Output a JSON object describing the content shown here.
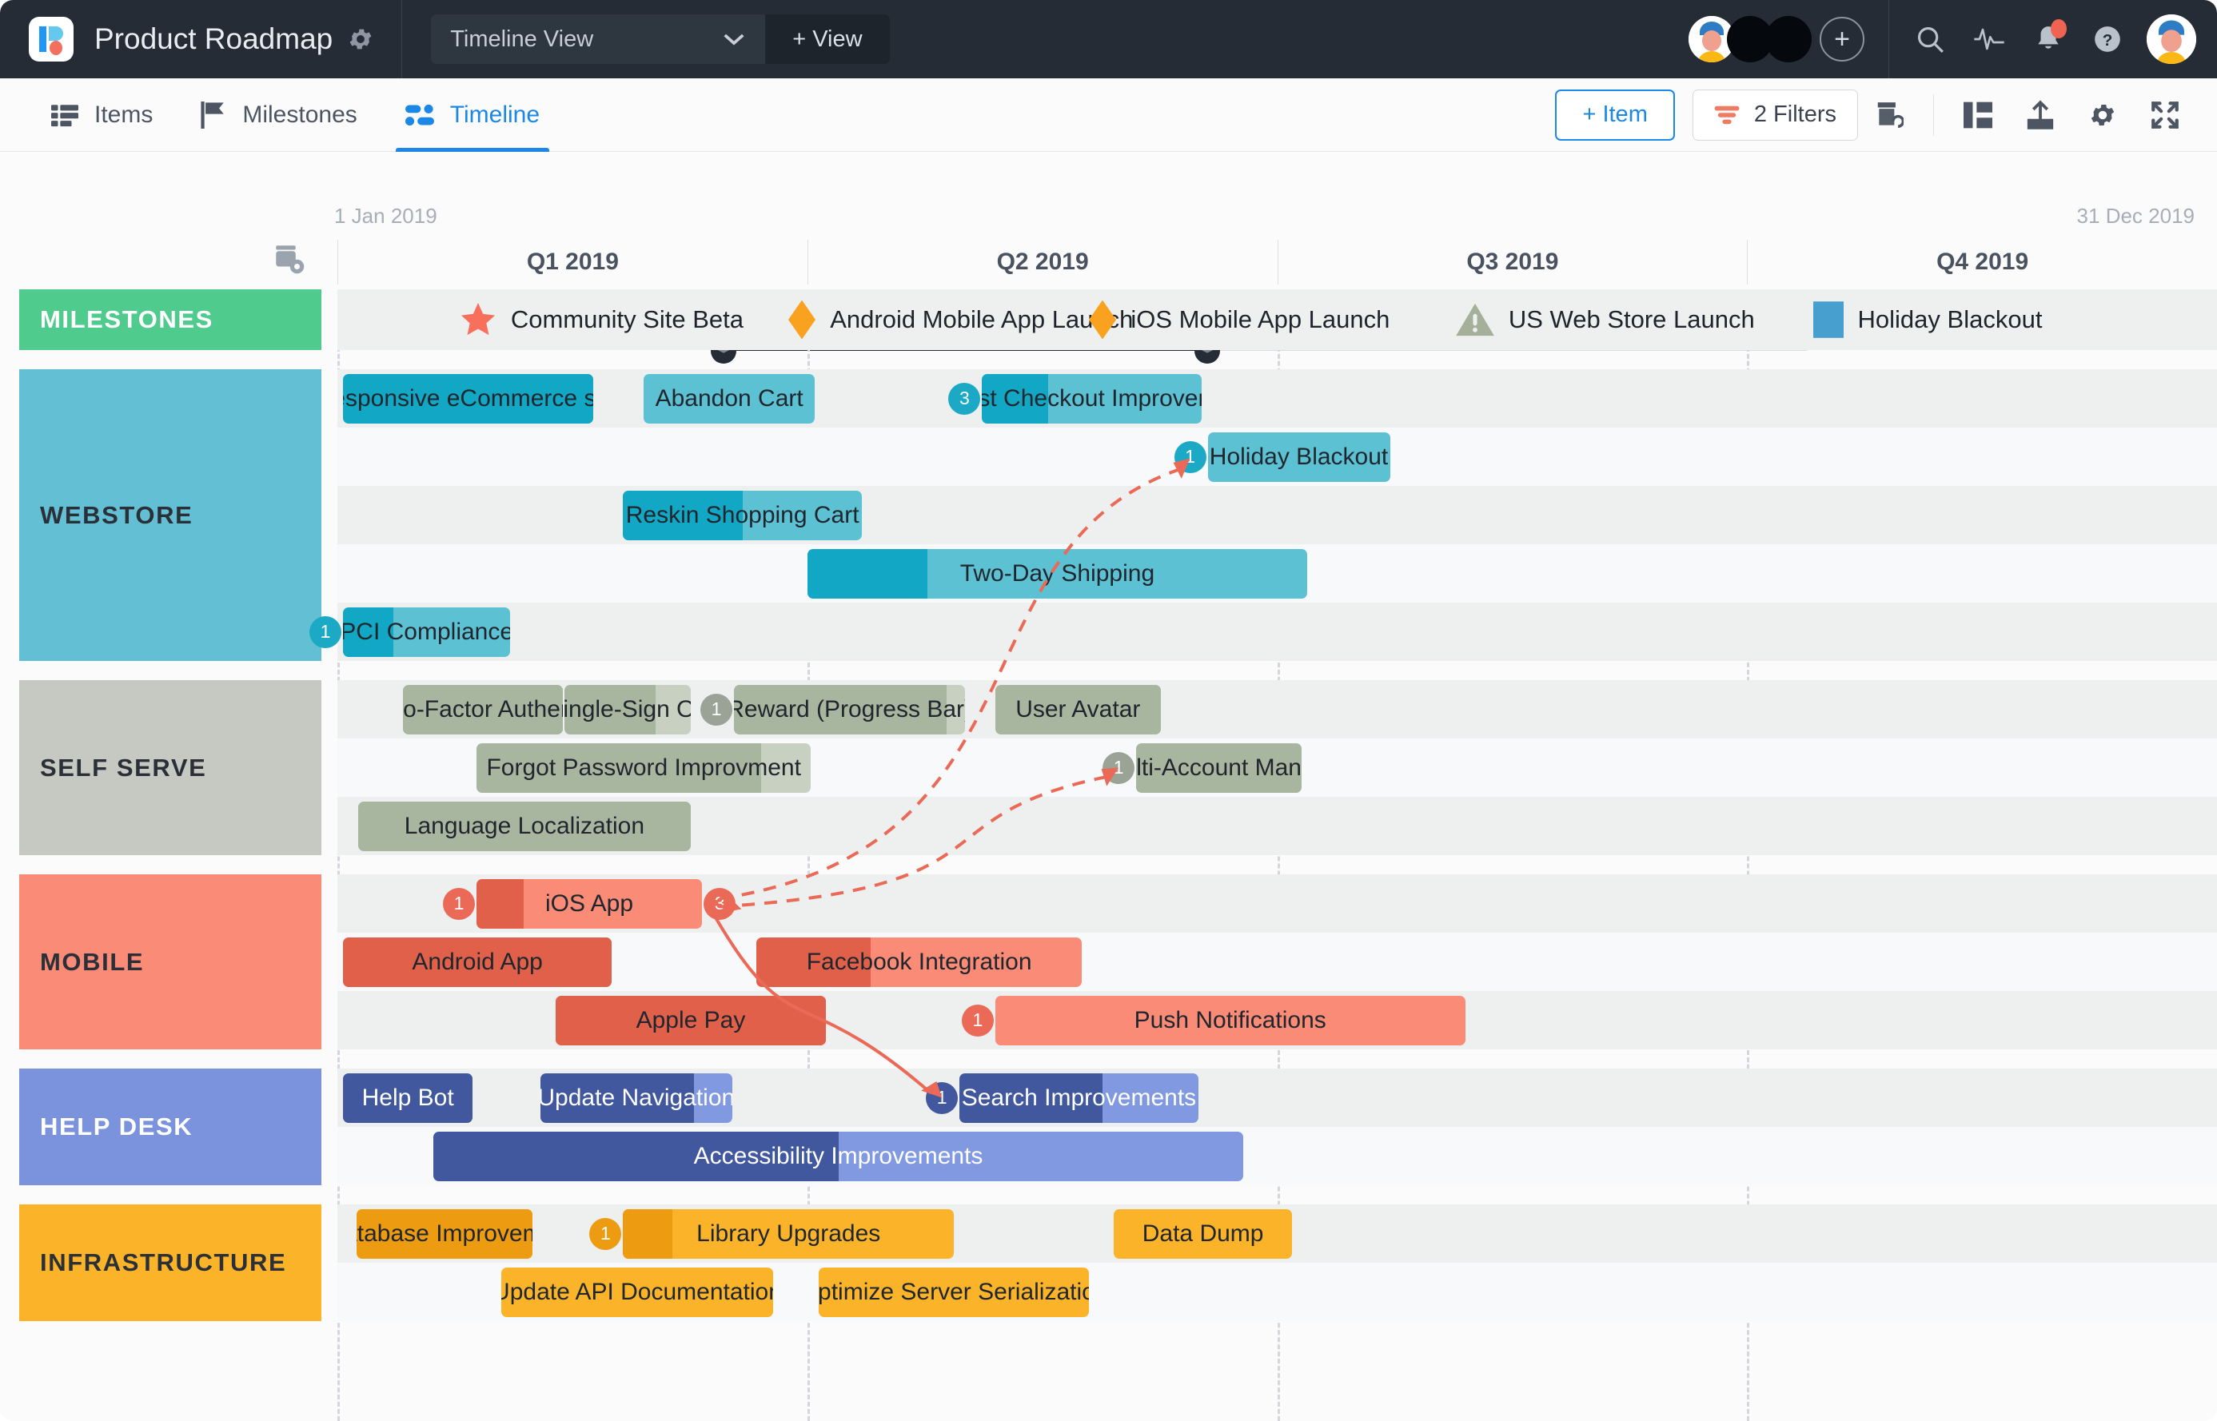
{
  "topbar": {
    "app_title": "Product Roadmap",
    "settings_icon": "gear-icon",
    "view_name": "Timeline View",
    "add_view_label": "+ View",
    "icons": [
      "search-icon",
      "activity-icon",
      "bell-icon",
      "help-icon"
    ]
  },
  "tabs": [
    {
      "label": "Items",
      "icon": "list-icon",
      "active": false
    },
    {
      "label": "Milestones",
      "icon": "flag-icon",
      "active": false
    },
    {
      "label": "Timeline",
      "icon": "timeline-icon",
      "active": true
    }
  ],
  "toolbar": {
    "add_item_label": "+ Item",
    "filters_label": "2 Filters",
    "icons": [
      "link-icon",
      "panel-layout-icon",
      "export-icon",
      "gear-icon",
      "fullscreen-icon"
    ]
  },
  "timeline": {
    "start_date": "1 Jan 2019",
    "end_date": "31 Dec 2019",
    "quarters": [
      "Q1 2019",
      "Q2 2019",
      "Q3 2019",
      "Q4 2019"
    ],
    "calendar_icon": "calendar-settings-icon"
  },
  "colors": {
    "milestones": "#4ecb8d",
    "webstore": "#63c0d4",
    "webstore_bar": "#5dc1d4",
    "webstore_fill": "#12a7c4",
    "self_serve": "#c5c9c1",
    "self_serve_bar": "#a8b6a0",
    "self_serve_fill": "#a8b6a0",
    "self_serve_rest": "#c7d0c1",
    "mobile": "#f98b77",
    "mobile_bar": "#f98b77",
    "mobile_fill": "#e0604a",
    "help_desk": "#7b93dd",
    "help_desk_bar": "#8199e0",
    "help_desk_fill": "#41589f",
    "infrastructure": "#fbb429",
    "infra_bar": "#fbb429",
    "infra_fill": "#ed9b10",
    "accent_blue": "#1b87e6",
    "arrow": "#ea6a57"
  },
  "lanes": [
    {
      "name": "MILESTONES",
      "text_color": "#ffffff",
      "bg": "#4ecb8d",
      "milestones": [
        {
          "label": "Community Site Beta",
          "icon": "star-icon",
          "color": "#f8705c",
          "left": 6.5
        },
        {
          "label": "Android Mobile App Launch",
          "icon": "diamond-icon",
          "color": "#f9a220",
          "left": 24.0
        },
        {
          "label": "iOS Mobile App Launch",
          "icon": "diamond-icon",
          "color": "#f9a220",
          "left": 40.0
        },
        {
          "label": "US Web Store Launch",
          "icon": "warning-icon",
          "color": "#a4b09a",
          "left": 59.5
        },
        {
          "label": "Holiday Blackout",
          "icon": "square-icon",
          "color": "#479fd0",
          "left": 78.5
        }
      ]
    },
    {
      "name": "WEBSTORE",
      "text_color": "#2b3038",
      "bg": "#63c0d4",
      "items": [
        {
          "label": "Responsive eCommerce site",
          "left": 0.3,
          "width": 13.3,
          "progress": 100,
          "row": 0
        },
        {
          "label": "Abandon Cart",
          "left": 16.3,
          "width": 9.1,
          "progress": 0,
          "row": 0
        },
        {
          "label": "Guest Checkout Improvement",
          "left": 34.3,
          "width": 11.7,
          "progress": 30,
          "row": 0,
          "badge": "3"
        },
        {
          "label": "Holiday Blackout",
          "left": 46.3,
          "width": 9.7,
          "progress": 0,
          "row": 1,
          "badge": "1"
        },
        {
          "label": "Reskin Shopping Cart",
          "left": 15.2,
          "width": 12.7,
          "progress": 50,
          "row": 2
        },
        {
          "label": "Two-Day Shipping",
          "left": 25.0,
          "width": 26.6,
          "progress": 24,
          "row": 3
        },
        {
          "label": "PCI Compliance",
          "left": 0.3,
          "width": 8.9,
          "progress": 30,
          "row": 4,
          "badge": "1"
        }
      ]
    },
    {
      "name": "SELF SERVE",
      "text_color": "#2b3038",
      "bg": "#c5c9c1",
      "items": [
        {
          "label": "Two-Factor Authen...",
          "left": 3.5,
          "width": 8.5,
          "progress": 100,
          "row": 0
        },
        {
          "label": "Single-Sign On",
          "left": 12.1,
          "width": 6.7,
          "progress": 72,
          "row": 0
        },
        {
          "label": "Reward (Progress Bar)",
          "left": 21.1,
          "width": 12.3,
          "progress": 92,
          "row": 0,
          "badge": "1"
        },
        {
          "label": "User Avatar",
          "left": 35.0,
          "width": 8.8,
          "progress": 100,
          "row": 0
        },
        {
          "label": "Forgot Password Improvment",
          "left": 7.4,
          "width": 17.8,
          "progress": 85,
          "row": 1
        },
        {
          "label": "Multi-Account Mana...",
          "left": 42.5,
          "width": 8.8,
          "progress": 100,
          "row": 1,
          "badge": "1"
        },
        {
          "label": "Language Localization",
          "left": 1.1,
          "width": 17.7,
          "progress": 100,
          "row": 2
        }
      ]
    },
    {
      "name": "MOBILE",
      "text_color": "#2b3038",
      "bg": "#f98b77",
      "items": [
        {
          "label": "iOS App",
          "left": 7.4,
          "width": 12.0,
          "progress": 21,
          "row": 0,
          "badge": "1",
          "badge2": "3"
        },
        {
          "label": "Android App",
          "left": 0.3,
          "width": 14.3,
          "progress": 100,
          "row": 1
        },
        {
          "label": "Facebook Integration",
          "left": 22.3,
          "width": 17.3,
          "progress": 35,
          "row": 1
        },
        {
          "label": "Apple Pay",
          "left": 11.6,
          "width": 14.4,
          "progress": 100,
          "row": 2
        },
        {
          "label": "Push Notifications",
          "left": 35.0,
          "width": 25.0,
          "progress": 0,
          "row": 2,
          "badge": "1"
        }
      ]
    },
    {
      "name": "HELP DESK",
      "text_color": "#ffffff",
      "bg": "#7b93dd",
      "items": [
        {
          "label": "Help Bot",
          "left": 0.3,
          "width": 6.9,
          "progress": 100,
          "row": 0
        },
        {
          "label": "Update Navigation",
          "left": 10.8,
          "width": 10.2,
          "progress": 80,
          "row": 0
        },
        {
          "label": "Search Improvements",
          "left": 33.1,
          "width": 12.7,
          "progress": 60,
          "row": 0,
          "badge": "1"
        },
        {
          "label": "Accessibility Improvements",
          "left": 5.1,
          "width": 43.1,
          "progress": 50,
          "row": 1
        }
      ]
    },
    {
      "name": "INFRASTRUCTURE",
      "text_color": "#2b3038",
      "bg": "#fbb429",
      "items": [
        {
          "label": "Database Improvem...",
          "left": 1.0,
          "width": 9.4,
          "progress": 100,
          "row": 0
        },
        {
          "label": "Library Upgrades",
          "left": 15.2,
          "width": 17.6,
          "progress": 15,
          "row": 0,
          "badge": "1"
        },
        {
          "label": "Data Dump",
          "left": 41.3,
          "width": 9.5,
          "progress": 0,
          "row": 0
        },
        {
          "label": "Update API Documentation",
          "left": 8.7,
          "width": 14.5,
          "progress": 0,
          "row": 1
        },
        {
          "label": "Optimize Server Serialization",
          "left": 25.6,
          "width": 14.4,
          "progress": 0,
          "row": 1
        }
      ]
    }
  ]
}
